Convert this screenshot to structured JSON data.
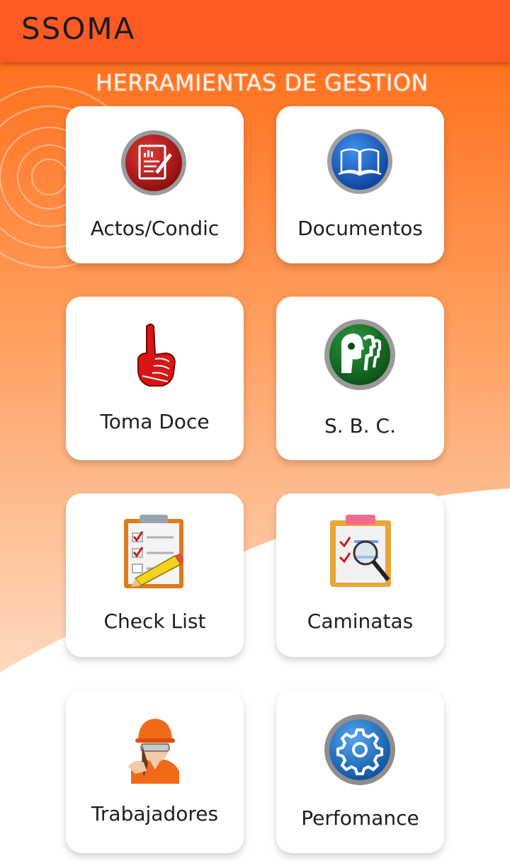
{
  "app": {
    "title": "SSOMA"
  },
  "heading": "HERRAMIENTAS DE GESTION",
  "tools": [
    {
      "label": "Actos/Condic",
      "icon": "report-edit-icon"
    },
    {
      "label": "Documentos",
      "icon": "open-book-icon"
    },
    {
      "label": "Toma Doce",
      "icon": "foam-finger-icon"
    },
    {
      "label": "S. B. C.",
      "icon": "profiles-icon"
    },
    {
      "label": "Check List",
      "icon": "checklist-clipboard-icon"
    },
    {
      "label": "Caminatas",
      "icon": "clipboard-magnifier-icon"
    },
    {
      "label": "Trabajadores",
      "icon": "worker-helmet-icon"
    },
    {
      "label": "Perfomance",
      "icon": "gear-icon"
    }
  ],
  "colors": {
    "appbar": "#ff5a24",
    "background_top": "#ff6a10",
    "background_bottom": "#ffffff"
  }
}
